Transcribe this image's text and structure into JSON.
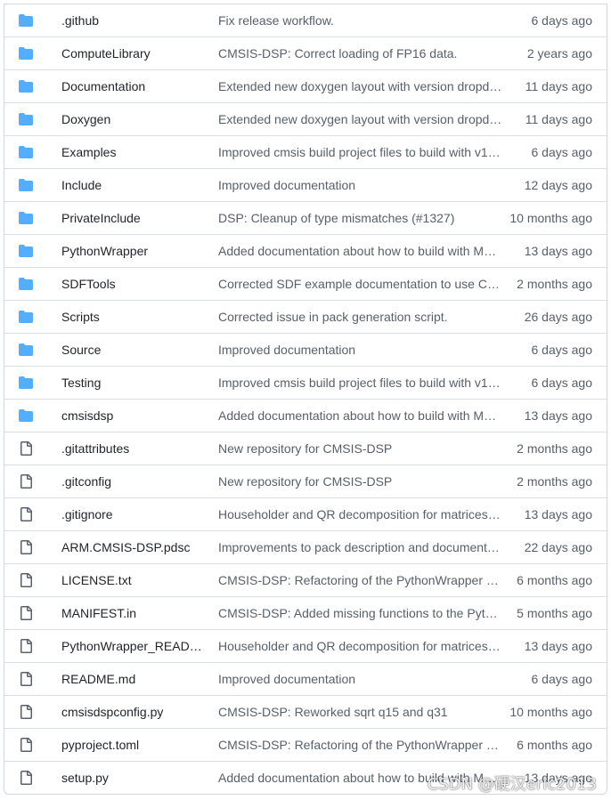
{
  "colors": {
    "folder_icon": "#54aeff",
    "file_icon": "#57606a",
    "border": "#d0d7de",
    "text": "#1f2328",
    "muted": "#57606a"
  },
  "files": [
    {
      "type": "folder",
      "icon": "folder-icon",
      "name": ".github",
      "message": "Fix release workflow.",
      "age": "6 days ago"
    },
    {
      "type": "folder",
      "icon": "folder-icon",
      "name": "ComputeLibrary",
      "message": "CMSIS-DSP: Correct loading of FP16 data.",
      "age": "2 years ago"
    },
    {
      "type": "folder",
      "icon": "folder-icon",
      "name": "Documentation",
      "message": "Extended new doxygen layout with version dropd…",
      "age": "11 days ago"
    },
    {
      "type": "folder",
      "icon": "folder-icon",
      "name": "Doxygen",
      "message": "Extended new doxygen layout with version dropd…",
      "age": "11 days ago"
    },
    {
      "type": "folder",
      "icon": "folder-icon",
      "name": "Examples",
      "message": "Improved cmsis build project files to build with v1.…",
      "age": "6 days ago"
    },
    {
      "type": "folder",
      "icon": "folder-icon",
      "name": "Include",
      "message": "Improved documentation",
      "age": "12 days ago"
    },
    {
      "type": "folder",
      "icon": "folder-icon",
      "name": "PrivateInclude",
      "message": "DSP: Cleanup of type mismatches (#1327)",
      "age": "10 months ago"
    },
    {
      "type": "folder",
      "icon": "folder-icon",
      "name": "PythonWrapper",
      "message": "Added documentation about how to build with M…",
      "age": "13 days ago"
    },
    {
      "type": "folder",
      "icon": "folder-icon",
      "name": "SDFTools",
      "message": "Corrected SDF example documentation to use CM…",
      "age": "2 months ago"
    },
    {
      "type": "folder",
      "icon": "folder-icon",
      "name": "Scripts",
      "message": "Corrected issue in pack generation script.",
      "age": "26 days ago"
    },
    {
      "type": "folder",
      "icon": "folder-icon",
      "name": "Source",
      "message": "Improved documentation",
      "age": "6 days ago"
    },
    {
      "type": "folder",
      "icon": "folder-icon",
      "name": "Testing",
      "message": "Improved cmsis build project files to build with v1.…",
      "age": "6 days ago"
    },
    {
      "type": "folder",
      "icon": "folder-icon",
      "name": "cmsisdsp",
      "message": "Added documentation about how to build with M…",
      "age": "13 days ago"
    },
    {
      "type": "file",
      "icon": "file-icon",
      "name": ".gitattributes",
      "message": "New repository for CMSIS-DSP",
      "age": "2 months ago"
    },
    {
      "type": "file",
      "icon": "file-icon",
      "name": ".gitconfig",
      "message": "New repository for CMSIS-DSP",
      "age": "2 months ago"
    },
    {
      "type": "file",
      "icon": "file-icon",
      "name": ".gitignore",
      "message": "Householder and QR decomposition for matrices (…",
      "age": "13 days ago"
    },
    {
      "type": "file",
      "icon": "file-icon",
      "name": "ARM.CMSIS-DSP.pdsc",
      "message": "Improvements to pack description and document…",
      "age": "22 days ago"
    },
    {
      "type": "file",
      "icon": "file-icon",
      "name": "LICENSE.txt",
      "message": "CMSIS-DSP: Refactoring of the PythonWrapper an…",
      "age": "6 months ago"
    },
    {
      "type": "file",
      "icon": "file-icon",
      "name": "MANIFEST.in",
      "message": "CMSIS-DSP: Added missing functions to the Pytho…",
      "age": "5 months ago"
    },
    {
      "type": "file",
      "icon": "file-icon",
      "name": "PythonWrapper_READ…",
      "message": "Householder and QR decomposition for matrices (…",
      "age": "13 days ago"
    },
    {
      "type": "file",
      "icon": "file-icon",
      "name": "README.md",
      "message": "Improved documentation",
      "age": "6 days ago"
    },
    {
      "type": "file",
      "icon": "file-icon",
      "name": "cmsisdspconfig.py",
      "message": "CMSIS-DSP: Reworked sqrt q15 and q31",
      "age": "10 months ago"
    },
    {
      "type": "file",
      "icon": "file-icon",
      "name": "pyproject.toml",
      "message": "CMSIS-DSP: Refactoring of the PythonWrapper an…",
      "age": "6 months ago"
    },
    {
      "type": "file",
      "icon": "file-icon",
      "name": "setup.py",
      "message": "Added documentation about how to build with M…",
      "age": "13 days ago"
    }
  ],
  "watermark": "CSDN @硬汉eric2013"
}
